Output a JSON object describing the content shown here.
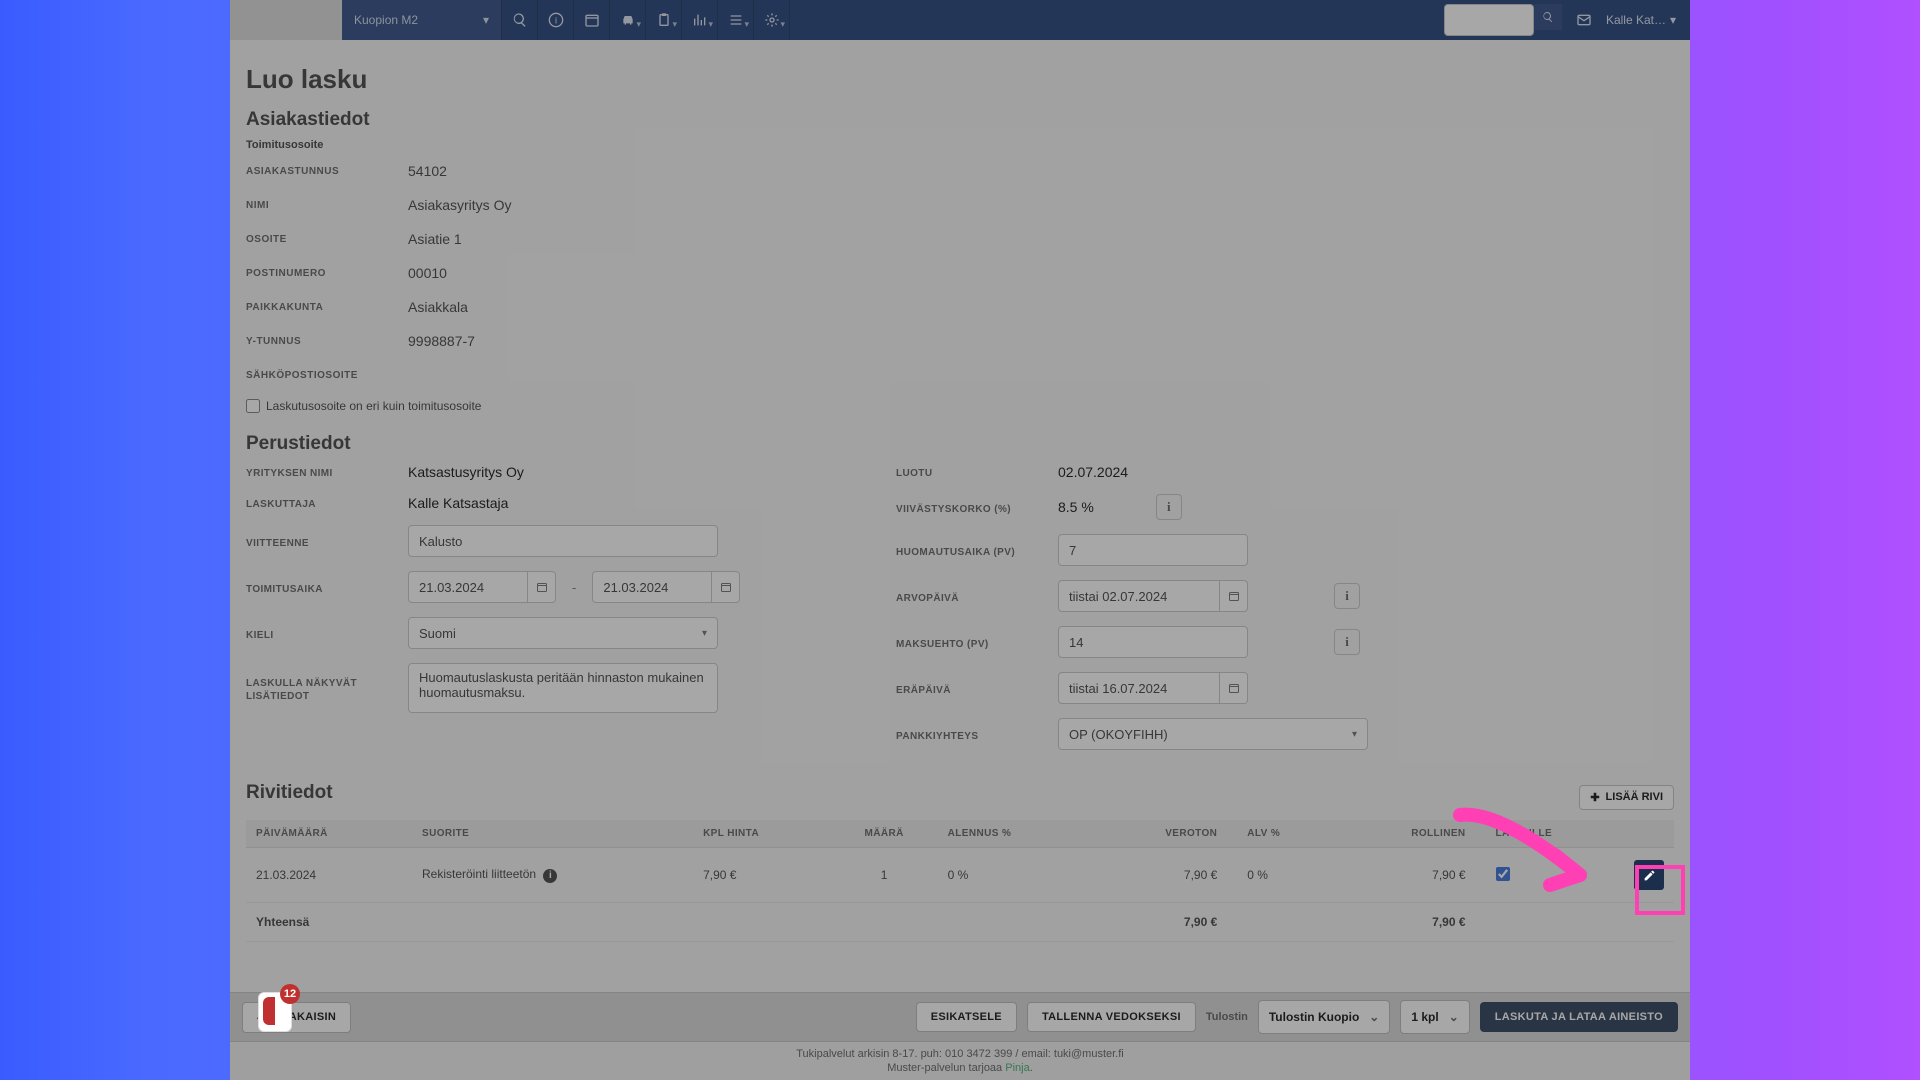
{
  "topbar": {
    "org": "Kuopion M2",
    "user": "Kalle Kat…"
  },
  "page": {
    "title": "Luo lasku",
    "section_customer": "Asiakastiedot",
    "delivery_label": "Toimitusosoite",
    "customer": {
      "id_label": "ASIAKASTUNNUS",
      "id": "54102",
      "name_label": "NIMI",
      "name": "Asiakasyritys Oy",
      "addr_label": "OSOITE",
      "addr": "Asiatie 1",
      "zip_label": "POSTINUMERO",
      "zip": "00010",
      "city_label": "PAIKKAKUNTA",
      "city": "Asiakkala",
      "ytunnus_label": "Y-TUNNUS",
      "ytunnus": "9998887-7",
      "email_label": "SÄHKÖPOSTIOSOITE",
      "email": ""
    },
    "diff_addr_label": "Laskutusosoite on eri kuin toimitusosoite",
    "section_basic": "Perustiedot",
    "basic": {
      "company_label": "YRITYKSEN NIMI",
      "company": "Katsastusyritys Oy",
      "biller_label": "LASKUTTAJA",
      "biller": "Kalle Katsastaja",
      "ref_label": "VIITTEENNE",
      "ref": "Kalusto",
      "delivery_period_label": "TOIMITUSAIKA",
      "date_from": "21.03.2024",
      "date_to": "21.03.2024",
      "lang_label": "KIELI",
      "lang": "Suomi",
      "notes_label": "LASKULLA NÄKYVÄT LISÄTIEDOT",
      "notes": "Huomautuslaskusta peritään hinnaston mukainen huomautusmaksu.",
      "created_label": "LUOTU",
      "created": "02.07.2024",
      "interest_label": "VIIVÄSTYSKORKO (%)",
      "interest": "8.5 %",
      "reminder_label": "HUOMAUTUSAIKA (PV)",
      "reminder": "7",
      "value_date_label": "ARVOPÄIVÄ",
      "value_date": "tiistai 02.07.2024",
      "payment_term_label": "MAKSUEHTO (PV)",
      "payment_term": "14",
      "due_label": "ERÄPÄIVÄ",
      "due": "tiistai 16.07.2024",
      "bank_label": "PANKKIYHTEYS",
      "bank": "OP (OKOYFIHH)"
    },
    "section_rows": "Rivitiedot",
    "add_row": "LISÄÄ RIVI",
    "headers": {
      "date": "PÄIVÄMÄÄRÄ",
      "item": "SUORITE",
      "unit": "KPL HINTA",
      "qty": "MÄÄRÄ",
      "disc": "ALENNUS %",
      "net": "VEROTON",
      "vat": "ALV %",
      "gross": "ROLLINEN",
      "on_inv": "LASKULLE"
    },
    "row": {
      "date": "21.03.2024",
      "item": "Rekisteröinti liitteetön",
      "unit": "7,90 €",
      "qty": "1",
      "disc": "0 %",
      "net": "7,90 €",
      "vat": "0 %",
      "gross": "7,90 €"
    },
    "totals": {
      "label": "Yhteensä",
      "net": "7,90 €",
      "gross": "7,90 €"
    }
  },
  "bottom": {
    "back": "TAKAISIN",
    "preview": "ESIKATSELE",
    "save_draft": "TALLENNA VEDOKSEKSI",
    "printer_label": "Tulostin",
    "printer": "Tulostin Kuopio",
    "copies": "1 kpl",
    "generate": "LASKUTA JA LATAA AINEISTO"
  },
  "footer": {
    "line1": "Tukipalvelut arkisin 8-17. puh: 010 3472 399 / email: tuki@muster.fi",
    "line2a": "Muster-palvelun tarjoaa ",
    "line2b": "Pinja"
  },
  "notif": {
    "count": "12"
  }
}
